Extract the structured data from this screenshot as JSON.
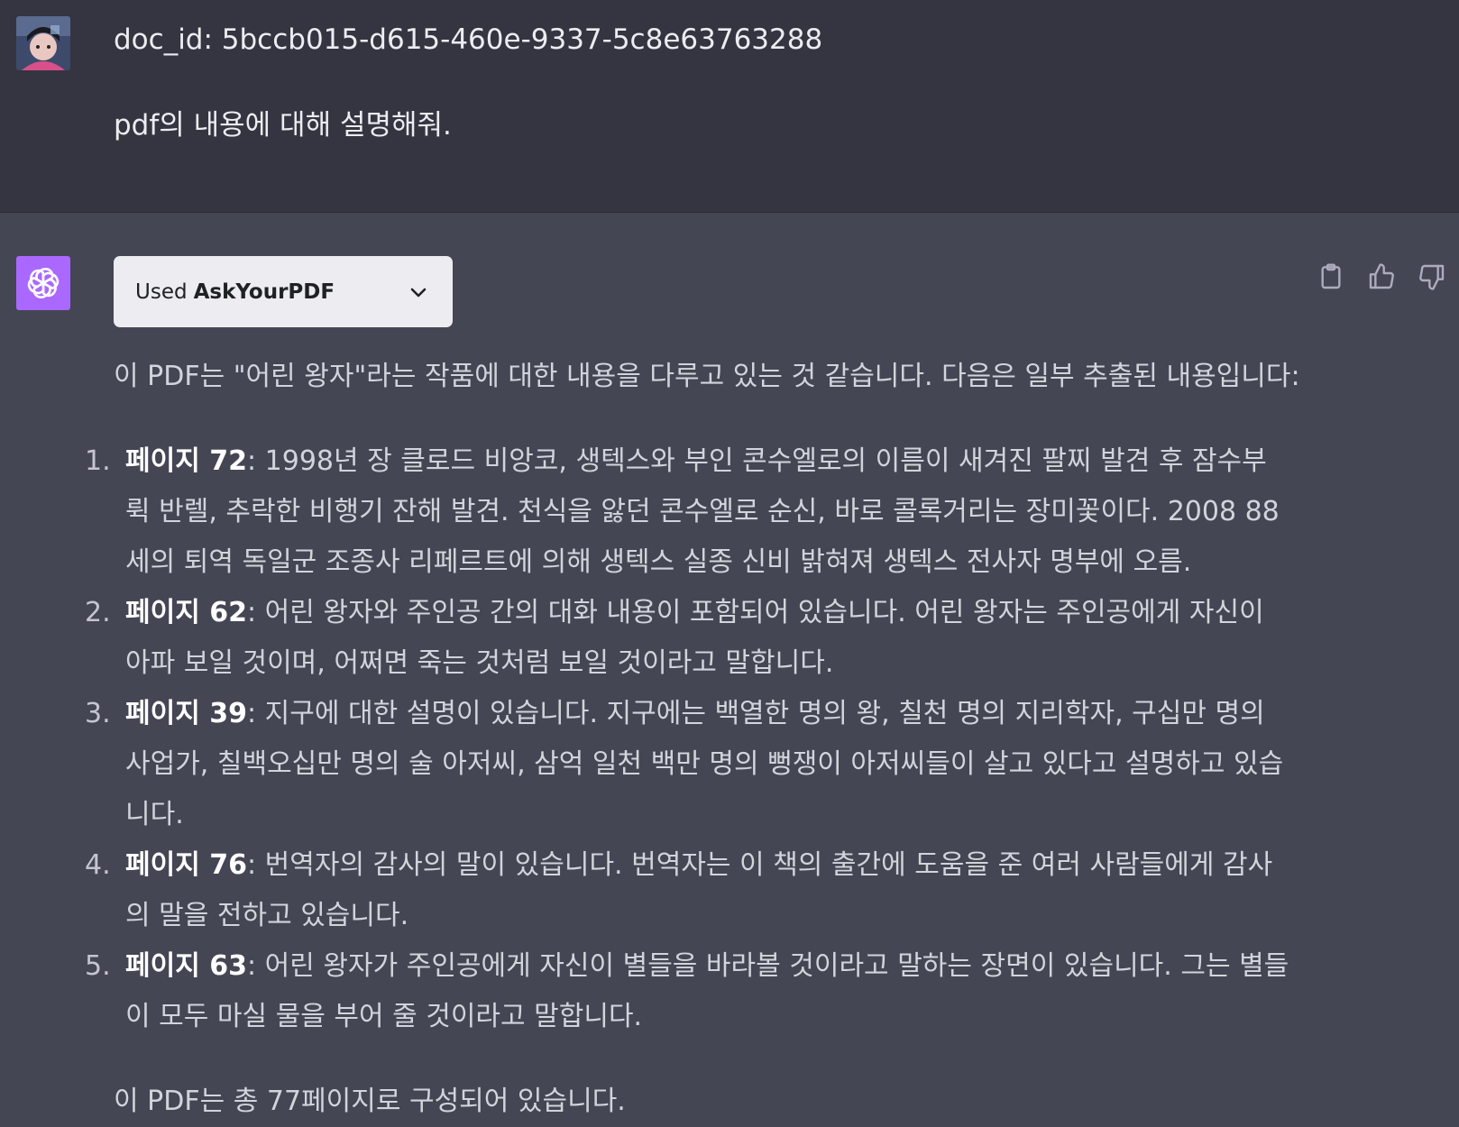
{
  "user_message": {
    "line1": "doc_id: 5bccb015-d615-460e-9337-5c8e63763288",
    "line2": "pdf의 내용에 대해 설명해줘."
  },
  "assistant_message": {
    "plugin": {
      "used_label": "Used",
      "plugin_name": "AskYourPDF"
    },
    "intro": "이 PDF는 \"어린 왕자\"라는 작품에 대한 내용을 다루고 있는 것 같습니다. 다음은 일부 추출된 내용입니다:",
    "items": [
      {
        "number": "1.",
        "label": "페이지 72",
        "text": ": 1998년 장 클로드 비앙코, 생텍스와 부인 콘수엘로의 이름이 새겨진 팔찌 발견 후 잠수부 뤽 반렐, 추락한 비행기 잔해 발견. 천식을 앓던 콘수엘로 순신, 바로 콜록거리는 장미꽃이다. 2008 88세의 퇴역 독일군 조종사 리페르트에 의해 생텍스 실종 신비 밝혀져 생텍스 전사자 명부에 오름."
      },
      {
        "number": "2.",
        "label": "페이지 62",
        "text": ": 어린 왕자와 주인공 간의 대화 내용이 포함되어 있습니다. 어린 왕자는 주인공에게 자신이 아파 보일 것이며, 어쩌면 죽는 것처럼 보일 것이라고 말합니다."
      },
      {
        "number": "3.",
        "label": "페이지 39",
        "text": ": 지구에 대한 설명이 있습니다. 지구에는 백열한 명의 왕, 칠천 명의 지리학자, 구십만 명의 사업가, 칠백오십만 명의 술 아저씨, 삼억 일천 백만 명의 뻥쟁이 아저씨들이 살고 있다고 설명하고 있습니다."
      },
      {
        "number": "4.",
        "label": "페이지 76",
        "text": ": 번역자의 감사의 말이 있습니다. 번역자는 이 책의 출간에 도움을 준 여러 사람들에게 감사의 말을 전하고 있습니다."
      },
      {
        "number": "5.",
        "label": "페이지 63",
        "text": ": 어린 왕자가 주인공에게 자신이 별들을 바라볼 것이라고 말하는 장면이 있습니다. 그는 별들이 모두 마실 물을 부어 줄 것이라고 말합니다."
      }
    ],
    "outro": "이 PDF는 총 77페이지로 구성되어 있습니다."
  },
  "icons": {
    "copy": "clipboard-icon",
    "like": "thumbs-up-icon",
    "dislike": "thumbs-down-icon",
    "expand": "chevron-down-icon"
  },
  "colors": {
    "user_bg": "#343541",
    "assistant_bg": "#444654",
    "gpt_avatar": "#ab68ff",
    "pill_bg": "#ececf1"
  }
}
